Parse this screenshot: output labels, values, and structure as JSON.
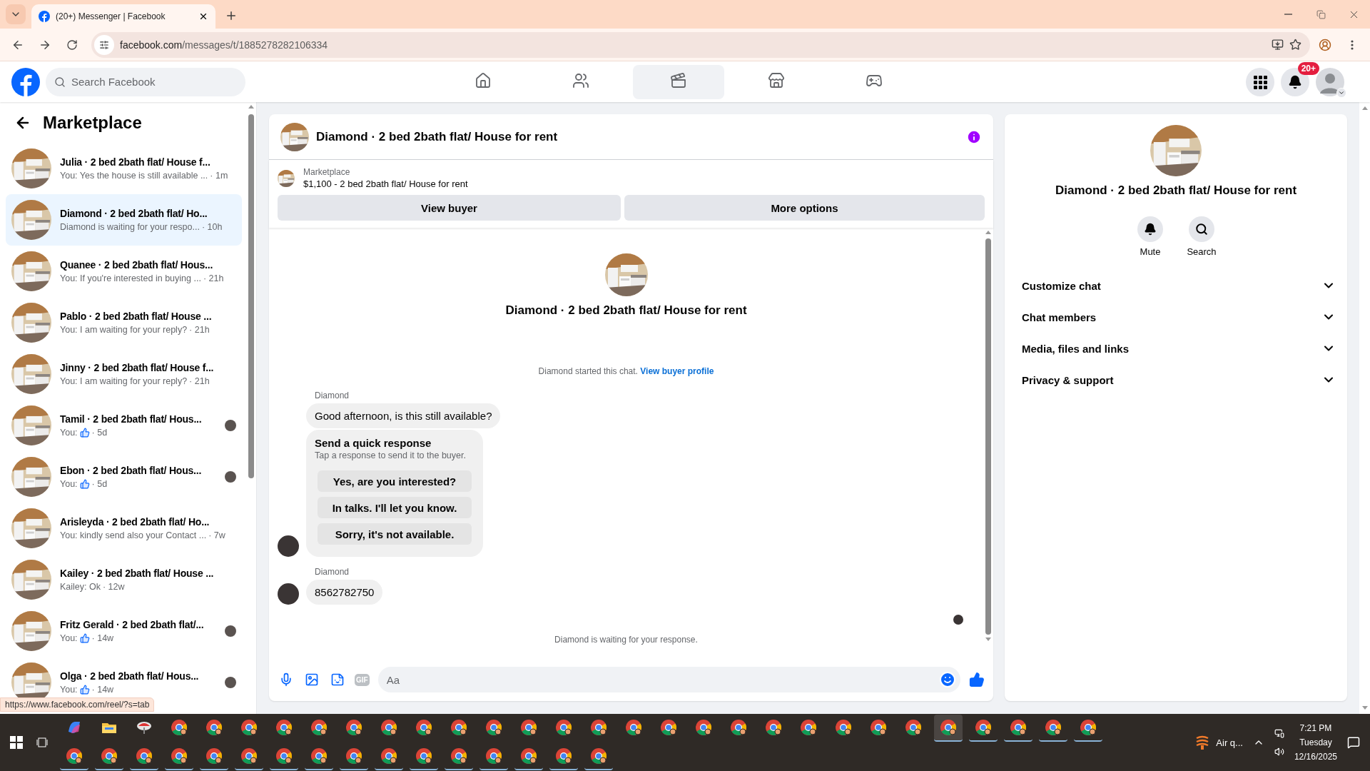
{
  "browser": {
    "tab_title": "(20+) Messenger | Facebook",
    "url_host": "facebook.com",
    "url_path": "/messages/t/1885278282106334",
    "status_url": "https://www.facebook.com/reel/?s=tab"
  },
  "header": {
    "search_placeholder": "Search Facebook",
    "nav": [
      {
        "kind": "home",
        "selected": false
      },
      {
        "kind": "friends",
        "selected": false
      },
      {
        "kind": "video",
        "selected": true
      },
      {
        "kind": "store",
        "selected": false
      },
      {
        "kind": "gaming",
        "selected": false
      }
    ],
    "notification_badge": "20+"
  },
  "sidebar": {
    "title": "Marketplace",
    "conversations": [
      {
        "name": "Julia · 2 bed 2bath flat/ House f...",
        "kind": "text",
        "preview": "You: Yes the house is still available ...",
        "time": "· 1m",
        "seen": false,
        "selected": false
      },
      {
        "name": "Diamond · 2 bed 2bath flat/ Ho...",
        "kind": "text",
        "preview": "Diamond is waiting for your respo...",
        "time": "· 10h",
        "seen": false,
        "selected": true
      },
      {
        "name": "Quanee · 2 bed 2bath flat/ Hous...",
        "kind": "text",
        "preview": "You: If you're interested in buying ...",
        "time": "· 21h",
        "seen": false,
        "selected": false
      },
      {
        "name": "Pablo · 2 bed 2bath flat/ House ...",
        "kind": "text",
        "preview": "You: I am waiting for your reply?",
        "time": "· 21h",
        "seen": false,
        "selected": false
      },
      {
        "name": "Jinny · 2 bed 2bath flat/ House f...",
        "kind": "text",
        "preview": "You: I am waiting for your reply?",
        "time": "· 21h",
        "seen": false,
        "selected": false
      },
      {
        "name": "Tamil · 2 bed 2bath flat/ Hous...",
        "kind": "like",
        "preview": "You:",
        "time": "· 5d",
        "seen": true,
        "selected": false
      },
      {
        "name": "Ebon · 2 bed 2bath flat/ Hous...",
        "kind": "like",
        "preview": "You:",
        "time": "· 5d",
        "seen": true,
        "selected": false
      },
      {
        "name": "Arisleyda · 2 bed 2bath flat/ Ho...",
        "kind": "text",
        "preview": "You: kindly send also your Contact ...",
        "time": "· 7w",
        "seen": false,
        "selected": false
      },
      {
        "name": "Kailey · 2 bed 2bath flat/ House ...",
        "kind": "text",
        "preview": "Kailey: Ok",
        "time": "· 12w",
        "seen": false,
        "selected": false
      },
      {
        "name": "Fritz Gerald · 2 bed 2bath flat/...",
        "kind": "like",
        "preview": "You:",
        "time": "· 14w",
        "seen": true,
        "selected": false
      },
      {
        "name": "Olga · 2 bed 2bath flat/ Hous...",
        "kind": "like",
        "preview": "You:",
        "time": "· 14w",
        "seen": true,
        "selected": false
      }
    ]
  },
  "chat": {
    "title": "Diamond · 2 bed 2bath flat/ House for rent",
    "listing_label": "Marketplace",
    "listing_title": "$1,100 - 2 bed 2bath flat/ House for rent",
    "actions": [
      "View buyer",
      "More options"
    ],
    "intro_title": "Diamond · 2 bed 2bath flat/ House for rent",
    "started_text": "Diamond started this chat.",
    "profile_link": "View buyer profile",
    "groups": [
      {
        "sender": "Diamond",
        "messages": [
          {
            "kind": "text",
            "text": "Good afternoon, is this still available?"
          },
          {
            "kind": "quick_replies",
            "title": "Send a quick response",
            "hint": "Tap a response to send it to the buyer.",
            "options": [
              "Yes, are you interested?",
              "In talks. I'll let you know.",
              "Sorry, it's not available."
            ]
          }
        ]
      },
      {
        "sender": "Diamond",
        "messages": [
          {
            "kind": "text",
            "text": "8562782750"
          }
        ]
      }
    ],
    "waiting_text": "Diamond is waiting for your response.",
    "composer": {
      "placeholder": "Aa",
      "gif_label": "GIF"
    }
  },
  "details": {
    "title": "Diamond · 2 bed 2bath flat/ House for rent",
    "actions": [
      {
        "kind": "mute",
        "label": "Mute"
      },
      {
        "kind": "search",
        "label": "Search"
      }
    ],
    "sections": [
      {
        "label": "Customize chat",
        "expanded": false
      },
      {
        "label": "Chat members",
        "expanded": false
      },
      {
        "label": "Media, files and links",
        "expanded": false
      },
      {
        "label": "Privacy & support",
        "expanded": false
      }
    ]
  },
  "taskbar": {
    "top_row": [
      {
        "kind": "copilot",
        "running": false,
        "selected": false
      },
      {
        "kind": "folder",
        "running": false,
        "selected": false
      },
      {
        "kind": "app",
        "running": false,
        "selected": false
      },
      {
        "kind": "browser",
        "running": false,
        "selected": false
      },
      {
        "kind": "browser",
        "running": false,
        "selected": false
      },
      {
        "kind": "browser",
        "running": false,
        "selected": false
      },
      {
        "kind": "browser",
        "running": false,
        "selected": false
      },
      {
        "kind": "browser",
        "running": false,
        "selected": false
      },
      {
        "kind": "browser",
        "running": false,
        "selected": false
      },
      {
        "kind": "browser",
        "running": false,
        "selected": false
      },
      {
        "kind": "browser",
        "running": false,
        "selected": false
      },
      {
        "kind": "browser",
        "running": false,
        "selected": false
      },
      {
        "kind": "browser",
        "running": false,
        "selected": false
      },
      {
        "kind": "browser",
        "running": false,
        "selected": false
      },
      {
        "kind": "browser",
        "running": false,
        "selected": false
      },
      {
        "kind": "browser",
        "running": false,
        "selected": false
      },
      {
        "kind": "browser",
        "running": false,
        "selected": false
      },
      {
        "kind": "browser",
        "running": false,
        "selected": false
      },
      {
        "kind": "browser",
        "running": false,
        "selected": false
      },
      {
        "kind": "browser",
        "running": false,
        "selected": false
      },
      {
        "kind": "browser",
        "running": false,
        "selected": false
      },
      {
        "kind": "browser",
        "running": false,
        "selected": false
      },
      {
        "kind": "browser",
        "running": false,
        "selected": false
      },
      {
        "kind": "browser",
        "running": false,
        "selected": false
      },
      {
        "kind": "browser",
        "running": false,
        "selected": false
      },
      {
        "kind": "browser",
        "running": true,
        "selected": true
      },
      {
        "kind": "browser",
        "running": true,
        "selected": false
      },
      {
        "kind": "browser",
        "running": true,
        "selected": false
      },
      {
        "kind": "browser",
        "running": true,
        "selected": false
      },
      {
        "kind": "browser",
        "running": true,
        "selected": false
      }
    ],
    "bottom_row": [
      {
        "kind": "browser",
        "running": true,
        "selected": false
      },
      {
        "kind": "browser",
        "running": true,
        "selected": false
      },
      {
        "kind": "browser",
        "running": true,
        "selected": false
      },
      {
        "kind": "browser",
        "running": true,
        "selected": false
      },
      {
        "kind": "browser",
        "running": true,
        "selected": false
      },
      {
        "kind": "browser",
        "running": true,
        "selected": false
      },
      {
        "kind": "browser",
        "running": true,
        "selected": false
      },
      {
        "kind": "browser",
        "running": true,
        "selected": false
      },
      {
        "kind": "browser",
        "running": true,
        "selected": false
      },
      {
        "kind": "browser",
        "running": true,
        "selected": false
      },
      {
        "kind": "browser",
        "running": true,
        "selected": false
      },
      {
        "kind": "browser",
        "running": true,
        "selected": false
      },
      {
        "kind": "browser",
        "running": true,
        "selected": false
      },
      {
        "kind": "browser",
        "running": true,
        "selected": false
      },
      {
        "kind": "browser",
        "running": true,
        "selected": false
      },
      {
        "kind": "browser",
        "running": true,
        "selected": false
      }
    ],
    "weather": "Air q...",
    "time": "7:21 PM",
    "day": "Tuesday",
    "date": "12/16/2025"
  }
}
